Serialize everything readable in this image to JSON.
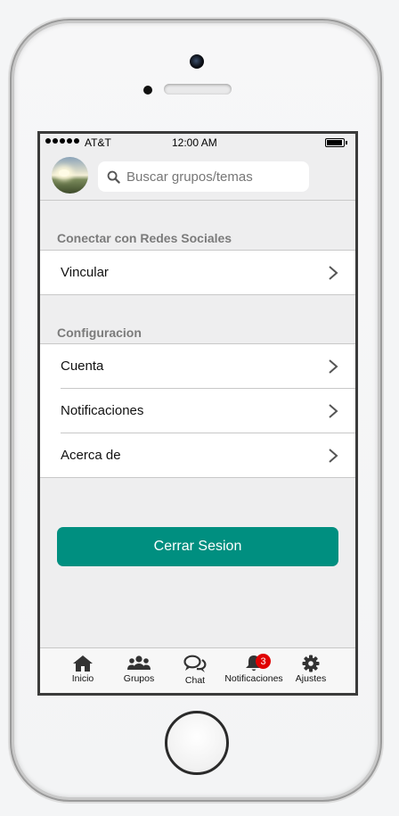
{
  "status_bar": {
    "carrier": "AT&T",
    "time": "12:00 AM"
  },
  "search": {
    "placeholder": "Buscar grupos/temas",
    "value": ""
  },
  "sections": {
    "social": {
      "title": "Conectar con Redes Sociales",
      "items": [
        {
          "label": "Vincular"
        }
      ]
    },
    "config": {
      "title": "Configuracion",
      "items": [
        {
          "label": "Cuenta"
        },
        {
          "label": "Notificaciones"
        },
        {
          "label": "Acerca de"
        }
      ]
    }
  },
  "logout_button": {
    "label": "Cerrar Sesion",
    "color": "#008f80"
  },
  "tabbar": {
    "tabs": [
      {
        "label": "Inicio",
        "icon": "home-icon"
      },
      {
        "label": "Grupos",
        "icon": "users-icon"
      },
      {
        "label": "Chat",
        "icon": "chat-icon"
      },
      {
        "label": "Notificaciones",
        "icon": "bell-icon",
        "badge": "3"
      },
      {
        "label": "Ajustes",
        "icon": "gear-icon"
      }
    ]
  },
  "colors": {
    "badge": "#e00000",
    "background": "#eeeeef"
  }
}
